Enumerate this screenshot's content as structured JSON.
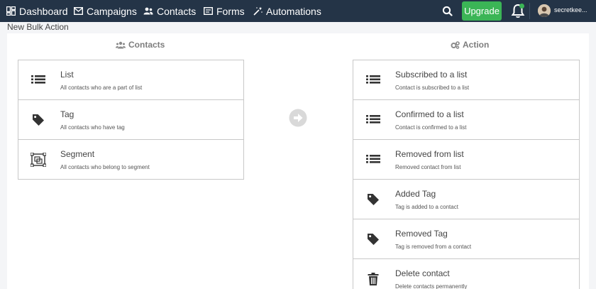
{
  "nav": {
    "items": [
      {
        "label": "Dashboard",
        "icon": "dashboard-icon"
      },
      {
        "label": "Campaigns",
        "icon": "envelope-icon"
      },
      {
        "label": "Contacts",
        "icon": "users-icon"
      },
      {
        "label": "Forms",
        "icon": "form-icon"
      },
      {
        "label": "Automations",
        "icon": "magic-wand-icon"
      }
    ],
    "upgrade_label": "Upgrade",
    "user_name": "secretkee..."
  },
  "page": {
    "title": "New Bulk Action"
  },
  "contacts_column": {
    "heading": "Contacts",
    "items": [
      {
        "title": "List",
        "description": "All contacts who are a part of list",
        "icon": "list-icon"
      },
      {
        "title": "Tag",
        "description": "All contacts who have tag",
        "icon": "tag-icon"
      },
      {
        "title": "Segment",
        "description": "All contacts who belong to segment",
        "icon": "segment-icon"
      }
    ]
  },
  "action_column": {
    "heading": "Action",
    "items": [
      {
        "title": "Subscribed to a list",
        "description": "Contact is subscribed to a list",
        "icon": "list-icon"
      },
      {
        "title": "Confirmed to a list",
        "description": "Contact is confirmed to a list",
        "icon": "list-icon"
      },
      {
        "title": "Removed from list",
        "description": "Removed contact from list",
        "icon": "list-icon"
      },
      {
        "title": "Added Tag",
        "description": "Tag is added to a contact",
        "icon": "tag-icon"
      },
      {
        "title": "Removed Tag",
        "description": "Tag is removed from a contact",
        "icon": "tag-icon"
      },
      {
        "title": "Delete contact",
        "description": "Delete contacts permanently",
        "icon": "trash-icon"
      }
    ]
  },
  "colors": {
    "topbar": "#243447",
    "upgrade": "#3bb556",
    "icon": "#333333"
  }
}
